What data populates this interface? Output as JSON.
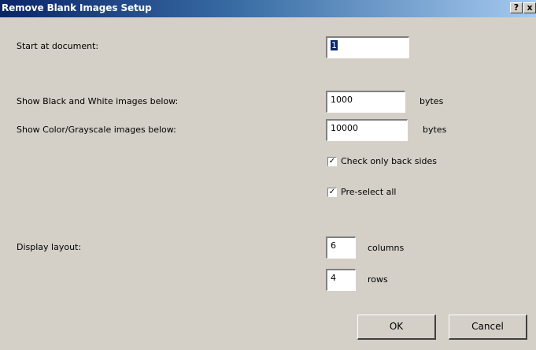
{
  "window": {
    "title": "Remove Blank Images Setup",
    "help_glyph": "?",
    "close_glyph": "x"
  },
  "start": {
    "label": "Start at document:",
    "value": "1"
  },
  "bw": {
    "label": "Show Black and White images below:",
    "value": "1000",
    "unit": "bytes"
  },
  "color": {
    "label": "Show Color/Grayscale images below:",
    "value": "10000",
    "unit": "bytes"
  },
  "options": {
    "back_sides": {
      "label": "Check only back sides",
      "checked": true
    },
    "preselect": {
      "label": "Pre-select all",
      "checked": true
    }
  },
  "layout": {
    "label": "Display layout:",
    "columns": "6",
    "columns_unit": "columns",
    "rows": "4",
    "rows_unit": "rows"
  },
  "buttons": {
    "ok": "OK",
    "cancel": "Cancel"
  },
  "check_glyph": "✓"
}
